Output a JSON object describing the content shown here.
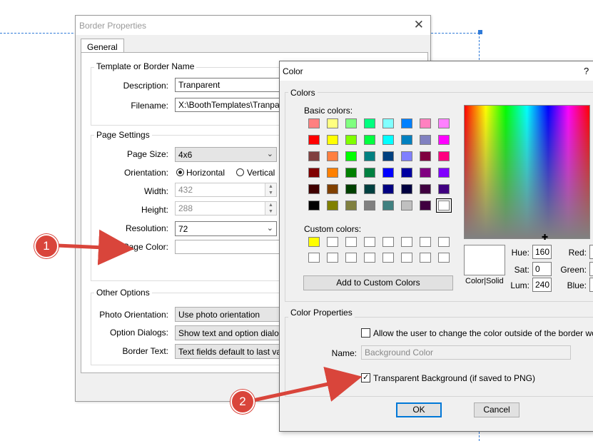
{
  "border_properties": {
    "title": "Border Properties",
    "close_glyph": "✕",
    "tab_general": "General",
    "template_group": {
      "label": "Template or Border Name",
      "description_label": "Description:",
      "description_value": "Tranparent",
      "filename_label": "Filename:",
      "filename_value": "X:\\BoothTemplates\\Tranparent"
    },
    "page_settings": {
      "label": "Page Settings",
      "page_size_label": "Page Size:",
      "page_size_value": "4x6",
      "orientation_label": "Orientation:",
      "orientation_horizontal": "Horizontal",
      "orientation_vertical": "Vertical",
      "width_label": "Width:",
      "width_value": "432",
      "height_label": "Height:",
      "height_value": "288",
      "resolution_label": "Resolution:",
      "resolution_value": "72",
      "page_color_label": "Page Color:"
    },
    "other_options": {
      "label": "Other Options",
      "photo_orientation_label": "Photo Orientation:",
      "photo_orientation_value": "Use photo orientation",
      "option_dialogs_label": "Option Dialogs:",
      "option_dialogs_value": "Show text and option dialogs o",
      "border_text_label": "Border Text:",
      "border_text_value": "Text fields default to last valu"
    }
  },
  "color_dialog": {
    "title": "Color",
    "help_glyph": "?",
    "colors_group_label": "Colors",
    "basic_colors_label": "Basic colors:",
    "basic_colors": [
      [
        "#ff8080",
        "#ffff80",
        "#80ff80",
        "#00ff80",
        "#80ffff",
        "#0080ff",
        "#ff80c0",
        "#ff80ff"
      ],
      [
        "#ff0000",
        "#ffff00",
        "#80ff00",
        "#00ff40",
        "#00ffff",
        "#0080c0",
        "#8080c0",
        "#ff00ff"
      ],
      [
        "#804040",
        "#ff8040",
        "#00ff00",
        "#008080",
        "#004080",
        "#8080ff",
        "#800040",
        "#ff0080"
      ],
      [
        "#800000",
        "#ff8000",
        "#008000",
        "#008040",
        "#0000ff",
        "#0000a0",
        "#800080",
        "#8000ff"
      ],
      [
        "#400000",
        "#804000",
        "#004000",
        "#004040",
        "#000080",
        "#000040",
        "#400040",
        "#400080"
      ],
      [
        "#000000",
        "#808000",
        "#808040",
        "#808080",
        "#408080",
        "#c0c0c0",
        "#400040",
        "#ffffff"
      ]
    ],
    "custom_colors_label": "Custom colors:",
    "custom_colors": [
      "#ffff00"
    ],
    "add_custom_button": "Add to Custom Colors",
    "color_solid_label": "Color|Solid",
    "hue_label": "Hue:",
    "hue_value": "160",
    "sat_label": "Sat:",
    "sat_value": "0",
    "lum_label": "Lum:",
    "lum_value": "240",
    "red_label": "Red:",
    "green_label": "Green:",
    "blue_label": "Blue:",
    "color_properties_label": "Color Properties",
    "allow_change_label": "Allow the user to change the color outside of the border worksho",
    "name_label": "Name:",
    "name_placeholder": "Background Color",
    "transparent_label": "Transparent Background (if saved to PNG)",
    "ok_button": "OK",
    "cancel_button": "Cancel"
  },
  "annotations": {
    "badge_1": "1",
    "badge_2": "2"
  },
  "colors": {
    "annotation_red": "#d9453b",
    "selection_blue": "#0078d7",
    "guide_blue": "#2f7ad8"
  }
}
